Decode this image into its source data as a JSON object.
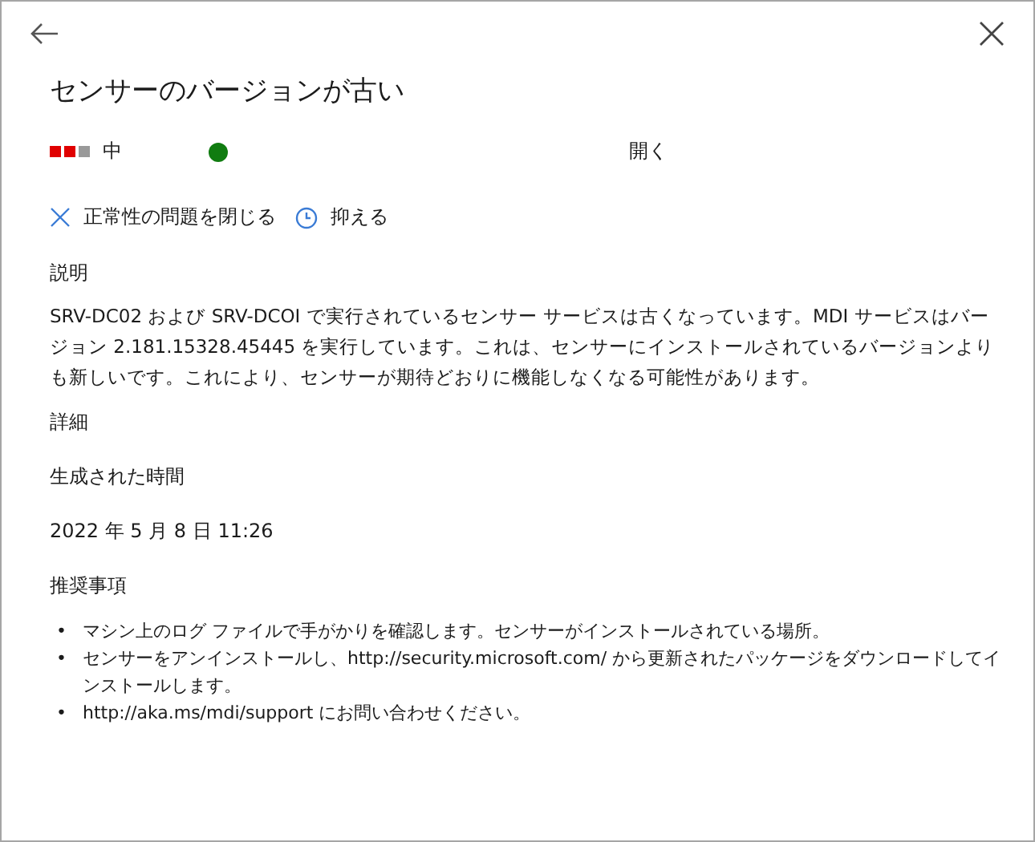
{
  "title": "センサーのバージョンが古い",
  "severity": {
    "bars": [
      {
        "on": true
      },
      {
        "on": true
      },
      {
        "on": false
      }
    ],
    "label": "中"
  },
  "status": {
    "color": "#107c10",
    "label": "開く"
  },
  "actions": [
    {
      "kind": "close",
      "label": "正常性の問題を閉じる"
    },
    {
      "kind": "suppress",
      "label": "抑える"
    }
  ],
  "description": {
    "heading": "説明",
    "text": "SRV-DC02 および SRV-DCOI で実行されているセンサー サービスは古くなっています。MDI サービスはバージョン 2.181.15328.45445 を実行しています。これは、センサーにインストールされているバージョンよりも新しいです。これにより、センサーが期待どおりに機能しなくなる可能性があります。"
  },
  "details": {
    "heading": "詳細",
    "label": "生成された時間",
    "value": "2022 年 5 月 8 日 11:26"
  },
  "recommendations": {
    "heading": "推奨事項",
    "marker": "•",
    "items": [
      [
        {
          "kind": "text",
          "text": "マシン上のログ ファイルで手がかりを確認します。センサーがインストールされている場所。"
        }
      ],
      [
        {
          "kind": "text",
          "text": "センサーをアンインストールし、"
        },
        {
          "kind": "link",
          "text": "http://security.microsoft.com/"
        },
        {
          "kind": "text",
          "text": " から更新されたパッケージをダウンロードしてインストールします。"
        }
      ],
      [
        {
          "kind": "link",
          "text": "http://aka.ms/mdi/support"
        },
        {
          "kind": "text",
          "text": " にお問い合わせください。"
        }
      ]
    ]
  }
}
